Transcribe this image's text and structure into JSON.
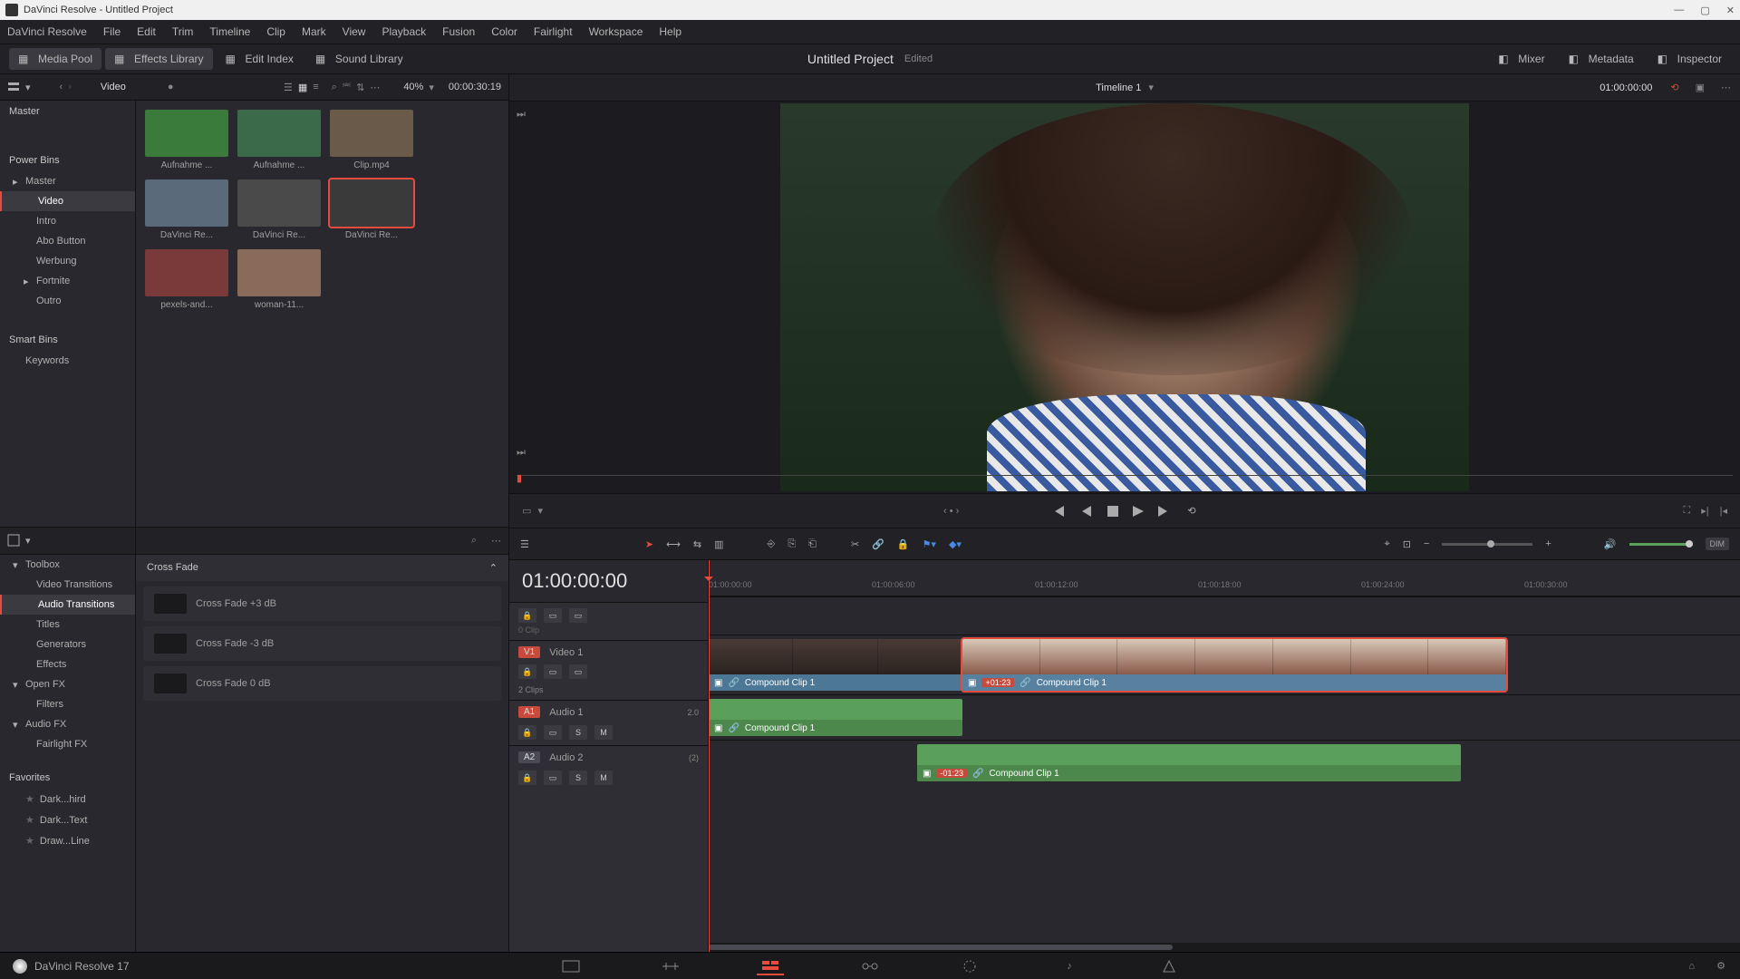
{
  "titlebar": {
    "appName": "DaVinci Resolve",
    "docName": "Untitled Project"
  },
  "menubar": [
    "DaVinci Resolve",
    "File",
    "Edit",
    "Trim",
    "Timeline",
    "Clip",
    "Mark",
    "View",
    "Playback",
    "Fusion",
    "Color",
    "Fairlight",
    "Workspace",
    "Help"
  ],
  "workspace": {
    "left": [
      {
        "name": "media-pool",
        "label": "Media Pool",
        "active": true
      },
      {
        "name": "effects-library",
        "label": "Effects Library",
        "active": true
      },
      {
        "name": "edit-index",
        "label": "Edit Index",
        "active": false
      },
      {
        "name": "sound-library",
        "label": "Sound Library",
        "active": false
      }
    ],
    "centerTitle": "Untitled Project",
    "centerStatus": "Edited",
    "right": [
      {
        "name": "mixer",
        "label": "Mixer"
      },
      {
        "name": "metadata",
        "label": "Metadata"
      },
      {
        "name": "inspector",
        "label": "Inspector"
      }
    ]
  },
  "poolHeader": {
    "breadcrumb": "Video",
    "zoom": "40%",
    "sourceTC": "00:00:30:19"
  },
  "bins": {
    "masterLabel": "Master",
    "powerBinsLabel": "Power Bins",
    "powerBins": [
      {
        "label": "Master",
        "level": 1,
        "expand": true
      },
      {
        "label": "Video",
        "level": 2,
        "sel": true
      },
      {
        "label": "Intro",
        "level": 2
      },
      {
        "label": "Abo Button",
        "level": 2
      },
      {
        "label": "Werbung",
        "level": 2
      },
      {
        "label": "Fortnite",
        "level": 2,
        "expand": true
      },
      {
        "label": "Outro",
        "level": 2
      }
    ],
    "smartBinsLabel": "Smart Bins",
    "smartBins": [
      {
        "label": "Keywords"
      }
    ]
  },
  "clips": [
    {
      "label": "Aufnahme ...",
      "thumb": "#3a7a3a"
    },
    {
      "label": "Aufnahme ...",
      "thumb": "#3a6a4a"
    },
    {
      "label": "Clip.mp4",
      "thumb": "#6a5a4a"
    },
    {
      "label": "DaVinci Re...",
      "thumb": "#5a6a7a"
    },
    {
      "label": "DaVinci Re...",
      "thumb": "#4a4a4a"
    },
    {
      "label": "DaVinci Re...",
      "thumb": "#3a3a3a",
      "sel": true
    },
    {
      "label": "pexels-and...",
      "thumb": "#7a3a3a"
    },
    {
      "label": "woman-11...",
      "thumb": "#8a6a5a"
    }
  ],
  "fx": {
    "tree": [
      {
        "label": "Toolbox",
        "level": 0,
        "expand": true
      },
      {
        "label": "Video Transitions",
        "level": 1
      },
      {
        "label": "Audio Transitions",
        "level": 1,
        "sel": true
      },
      {
        "label": "Titles",
        "level": 1
      },
      {
        "label": "Generators",
        "level": 1
      },
      {
        "label": "Effects",
        "level": 1
      },
      {
        "label": "Open FX",
        "level": 0,
        "expand": true
      },
      {
        "label": "Filters",
        "level": 1
      },
      {
        "label": "Audio FX",
        "level": 0,
        "expand": true
      },
      {
        "label": "Fairlight FX",
        "level": 1
      }
    ],
    "favoritesLabel": "Favorites",
    "favorites": [
      "Dark...hird",
      "Dark...Text",
      "Draw...Line"
    ],
    "groupTitle": "Cross Fade",
    "items": [
      "Cross Fade +3 dB",
      "Cross Fade -3 dB",
      "Cross Fade 0 dB"
    ]
  },
  "viewer": {
    "timelineName": "Timeline 1",
    "recordTC": "01:00:00:00"
  },
  "timeline": {
    "tc": "01:00:00:00",
    "rulerTicks": [
      "01:00:00:00",
      "01:00:06:00",
      "01:00:12:00",
      "01:00:18:00",
      "01:00:24:00",
      "01:00:30:00"
    ],
    "tracks": {
      "v2": {
        "badge": "",
        "name": "",
        "clips": "0 Clip"
      },
      "v1": {
        "badge": "V1",
        "name": "Video 1",
        "clips": "2 Clips"
      },
      "a1": {
        "badge": "A1",
        "name": "Audio 1",
        "ch": "2.0"
      },
      "a2": {
        "badge": "A2",
        "name": "Audio 2",
        "ch": "(2)"
      }
    },
    "clips": {
      "v1a": {
        "label": "Compound Clip 1"
      },
      "v1b": {
        "label": "Compound Clip 1",
        "offset": "+01:23"
      },
      "a1": {
        "label": "Compound Clip 1"
      },
      "a2": {
        "label": "Compound Clip 1",
        "offset": "-01:23"
      }
    }
  },
  "footer": {
    "version": "DaVinci Resolve 17"
  }
}
